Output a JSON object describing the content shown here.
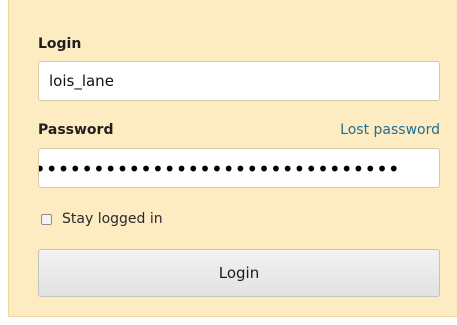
{
  "form": {
    "login_label": "Login",
    "login_value": "lois_lane",
    "password_label": "Password",
    "lost_password_link": "Lost password",
    "password_masked": "•••••••••••••••••••••••••••••••",
    "stay_logged_in_label": "Stay logged in",
    "stay_logged_in_checked": false,
    "submit_label": "Login"
  },
  "colors": {
    "panel_background": "#fdebc2",
    "link": "#1f6f95"
  }
}
